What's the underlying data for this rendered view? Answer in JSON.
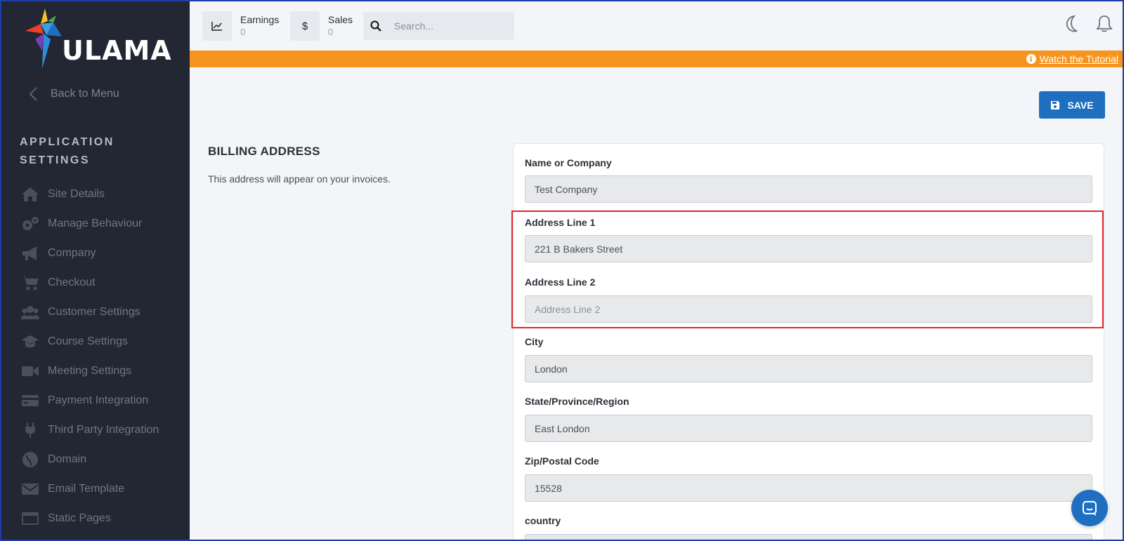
{
  "brand": {
    "name": "ULAMA"
  },
  "sidebar": {
    "back_label": "Back to Menu",
    "section_title_1": "APPLICATION",
    "section_title_2": "SETTINGS",
    "items": [
      {
        "label": "Site Details",
        "icon": "home-icon"
      },
      {
        "label": "Manage Behaviour",
        "icon": "gears-icon"
      },
      {
        "label": "Company",
        "icon": "megaphone-icon"
      },
      {
        "label": "Checkout",
        "icon": "cart-icon"
      },
      {
        "label": "Customer Settings",
        "icon": "users-icon"
      },
      {
        "label": "Course Settings",
        "icon": "graduation-cap-icon"
      },
      {
        "label": "Meeting Settings",
        "icon": "video-icon"
      },
      {
        "label": "Payment Integration",
        "icon": "credit-card-icon"
      },
      {
        "label": "Third Party Integration",
        "icon": "plug-icon"
      },
      {
        "label": "Domain",
        "icon": "globe-icon"
      },
      {
        "label": "Email Template",
        "icon": "envelope-icon"
      },
      {
        "label": "Static Pages",
        "icon": "window-icon"
      }
    ]
  },
  "topbar": {
    "earnings_label": "Earnings",
    "earnings_value": "0",
    "sales_label": "Sales",
    "sales_value": "0",
    "sales_icon_glyph": "$",
    "search_placeholder": "Search..."
  },
  "banner": {
    "link_text": "Watch the Tutorial",
    "info_glyph": "i"
  },
  "main": {
    "save_label": "SAVE",
    "section_title": "BILLING ADDRESS",
    "section_desc": "This address will appear on your invoices."
  },
  "form": {
    "name_label": "Name or Company",
    "name_value": "Test Company",
    "address1_label": "Address Line 1",
    "address1_value": "221 B Bakers Street",
    "address2_label": "Address Line 2",
    "address2_placeholder": "Address Line 2",
    "city_label": "City",
    "city_value": "London",
    "state_label": "State/Province/Region",
    "state_value": "East London",
    "zip_label": "Zip/Postal Code",
    "zip_value": "15528",
    "country_label": "country"
  },
  "colors": {
    "sidebar_bg": "#232734",
    "banner": "#f7941d",
    "primary": "#1e6fc0",
    "highlight": "#e3262a"
  }
}
